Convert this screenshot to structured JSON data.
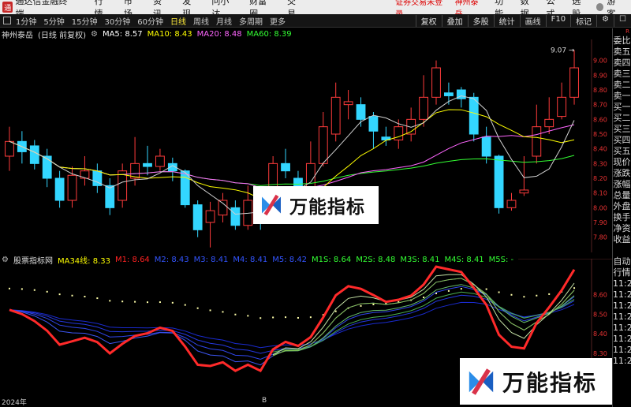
{
  "menubar": {
    "app_title": "通达信金融终端",
    "items": [
      "行情",
      "市场",
      "资讯",
      "发现",
      "问小达",
      "财富圈",
      "交易"
    ],
    "notice": "证券交易未登录",
    "stock": "神州泰岳",
    "right_items": [
      "功能",
      "数据",
      "公式",
      "选股"
    ],
    "guest": "游客"
  },
  "toolbar": {
    "periods": [
      "1分钟",
      "5分钟",
      "15分钟",
      "30分钟",
      "60分钟",
      "日线",
      "周线",
      "月线",
      "多周期",
      "更多"
    ],
    "active_period": "日线",
    "right_buttons": [
      "复权",
      "叠加",
      "多股",
      "统计",
      "画线",
      "F10",
      "标记",
      "⚙",
      "☐"
    ]
  },
  "main_info": {
    "name": "神州泰岳",
    "mode": "(日线 前复权)",
    "ma": [
      {
        "label": "MA5: 8.57",
        "color": "#ffffff"
      },
      {
        "label": "MA10: 8.43",
        "color": "#ffff00"
      },
      {
        "label": "MA20: 8.48",
        "color": "#ff66ff"
      },
      {
        "label": "MA60: 8.39",
        "color": "#33ff33"
      }
    ]
  },
  "sub_info": {
    "name": "股票指标网",
    "items": [
      {
        "label": "MA34线: 8.33",
        "color": "#ffff00"
      },
      {
        "label": "M1: 8.64",
        "color": "#ff2222"
      },
      {
        "label": "M2: 8.43",
        "color": "#3355ff"
      },
      {
        "label": "M3: 8.41",
        "color": "#3355ff"
      },
      {
        "label": "M4: 8.41",
        "color": "#3355ff"
      },
      {
        "label": "M5: 8.42",
        "color": "#3355ff"
      },
      {
        "label": "M1S: 8.64",
        "color": "#33ff33"
      },
      {
        "label": "M2S: 8.48",
        "color": "#33ff33"
      },
      {
        "label": "M3S: 8.41",
        "color": "#33ff33"
      },
      {
        "label": "M4S: 8.41",
        "color": "#33ff33"
      },
      {
        "label": "M5S: -",
        "color": "#33ff33"
      }
    ]
  },
  "right_panel": {
    "top": "R\n500",
    "items": [
      "委比",
      "卖五",
      "卖四",
      "卖三",
      "卖二",
      "卖一",
      "买一",
      "买二",
      "买三",
      "买四",
      "买五",
      "现价",
      "涨跌",
      "涨幅",
      "总量",
      "外盘",
      "换手",
      "净资",
      "收益",
      "",
      "自动",
      "行情",
      "11:2",
      "11:2",
      "11:2",
      "11:2",
      "11:2",
      "11:2",
      "11:2",
      "11:2"
    ]
  },
  "chart_data": [
    {
      "type": "candlestick",
      "title": "神州泰岳 (日线 前复权)",
      "ylim": [
        7.75,
        9.1
      ],
      "y_ticks": [
        7.8,
        7.9,
        8.0,
        8.1,
        8.2,
        8.3,
        8.4,
        8.5,
        8.6,
        8.7,
        8.8,
        8.9,
        9.0
      ],
      "annotations": [
        {
          "text": "9.07",
          "value": 9.07
        },
        {
          "text": "7.73",
          "value": 7.73
        }
      ],
      "candles": [
        [
          8.35,
          8.45,
          8.55,
          8.25
        ],
        [
          8.45,
          8.38,
          8.52,
          8.3
        ],
        [
          8.42,
          8.3,
          8.46,
          8.26
        ],
        [
          8.35,
          8.2,
          8.4,
          8.14
        ],
        [
          8.2,
          8.05,
          8.25,
          8.0
        ],
        [
          8.05,
          8.22,
          8.28,
          8.0
        ],
        [
          8.2,
          8.25,
          8.35,
          8.15
        ],
        [
          8.25,
          8.15,
          8.3,
          8.1
        ],
        [
          8.15,
          8.0,
          8.2,
          7.95
        ],
        [
          8.05,
          8.25,
          8.3,
          8.0
        ],
        [
          8.2,
          8.3,
          8.48,
          8.15
        ],
        [
          8.3,
          8.28,
          8.42,
          8.22
        ],
        [
          8.28,
          8.35,
          8.4,
          8.25
        ],
        [
          8.3,
          8.25,
          8.34,
          8.18
        ],
        [
          8.25,
          8.02,
          8.26,
          8.0
        ],
        [
          8.02,
          7.85,
          8.05,
          7.8
        ],
        [
          7.9,
          7.98,
          8.04,
          7.73
        ],
        [
          7.95,
          8.05,
          8.1,
          7.9
        ],
        [
          8.0,
          7.88,
          8.05,
          7.85
        ],
        [
          7.88,
          8.05,
          8.15,
          7.85
        ],
        [
          7.95,
          7.9,
          8.1,
          7.85
        ],
        [
          7.95,
          8.3,
          8.35,
          7.9
        ],
        [
          8.3,
          8.25,
          8.4,
          8.2
        ],
        [
          8.2,
          8.12,
          8.25,
          8.05
        ],
        [
          8.1,
          8.3,
          8.45,
          8.08
        ],
        [
          8.3,
          8.55,
          8.65,
          8.28
        ],
        [
          8.5,
          8.75,
          8.85,
          8.45
        ],
        [
          8.7,
          8.72,
          8.8,
          8.6
        ],
        [
          8.7,
          8.6,
          8.75,
          8.55
        ],
        [
          8.62,
          8.52,
          8.65,
          8.4
        ],
        [
          8.48,
          8.46,
          8.55,
          8.42
        ],
        [
          8.46,
          8.55,
          8.6,
          8.4
        ],
        [
          8.5,
          8.6,
          8.68,
          8.45
        ],
        [
          8.6,
          8.75,
          8.9,
          8.55
        ],
        [
          8.75,
          8.95,
          9.0,
          8.7
        ],
        [
          8.78,
          8.76,
          8.85,
          8.7
        ],
        [
          8.8,
          8.74,
          8.82,
          8.68
        ],
        [
          8.75,
          8.5,
          8.78,
          8.45
        ],
        [
          8.48,
          8.35,
          8.55,
          8.3
        ],
        [
          8.35,
          8.0,
          8.36,
          7.96
        ],
        [
          8.0,
          8.05,
          8.1,
          7.98
        ],
        [
          8.1,
          8.12,
          8.35,
          8.08
        ],
        [
          8.35,
          8.55,
          8.7,
          8.3
        ],
        [
          8.55,
          8.6,
          8.75,
          8.5
        ],
        [
          8.62,
          8.75,
          8.85,
          8.6
        ],
        [
          8.75,
          8.95,
          9.07,
          8.7
        ]
      ]
    },
    {
      "type": "line",
      "title": "股票指标网",
      "ylim": [
        8.1,
        8.75
      ],
      "y_ticks": [
        8.2,
        8.3,
        8.4,
        8.5,
        8.6
      ]
    }
  ],
  "right_axis_label": "R",
  "bottom_bar": {
    "left": "2024年",
    "mid": "B"
  }
}
